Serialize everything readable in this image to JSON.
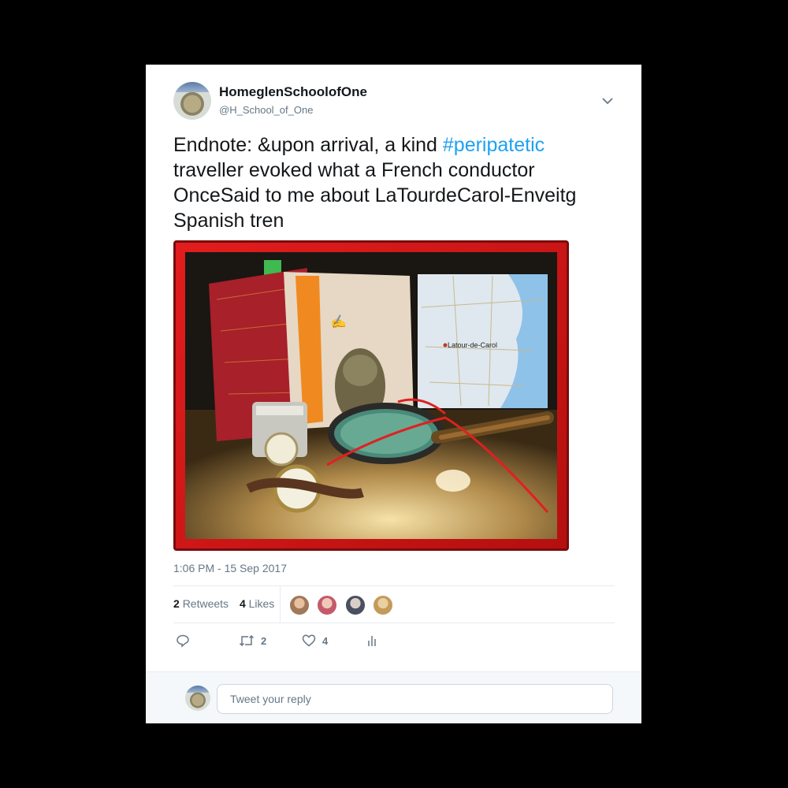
{
  "user": {
    "name": "HomeglenSchoolofOne",
    "handle": "@H_School_of_One"
  },
  "tweet": {
    "text_before": "Endnote: &upon arrival, a kind ",
    "hashtag": "#peripatetic",
    "text_after": " traveller evoked what a French conductor OnceSaid to me about LaTourdeCarol-Enveitg Spanish tren",
    "timestamp": "1:06 PM - 15 Sep 2017"
  },
  "photo": {
    "map_label": "Latour-de-Carol",
    "frame_color": "#e21d1d"
  },
  "stats": {
    "retweets_count": "2",
    "retweets_label": "Retweets",
    "likes_count": "4",
    "likes_label": "Likes",
    "liker_avatar_colors": [
      "#a0785a",
      "#c45a6a",
      "#4a5060",
      "#c49a5a"
    ]
  },
  "actions": {
    "reply_icon": "reply-icon",
    "retweet_count": "2",
    "like_count": "4",
    "analytics_icon": "analytics-icon"
  },
  "reply": {
    "placeholder": "Tweet your reply"
  },
  "colors": {
    "link": "#1da1f2",
    "muted": "#657786",
    "text": "#14171a"
  }
}
